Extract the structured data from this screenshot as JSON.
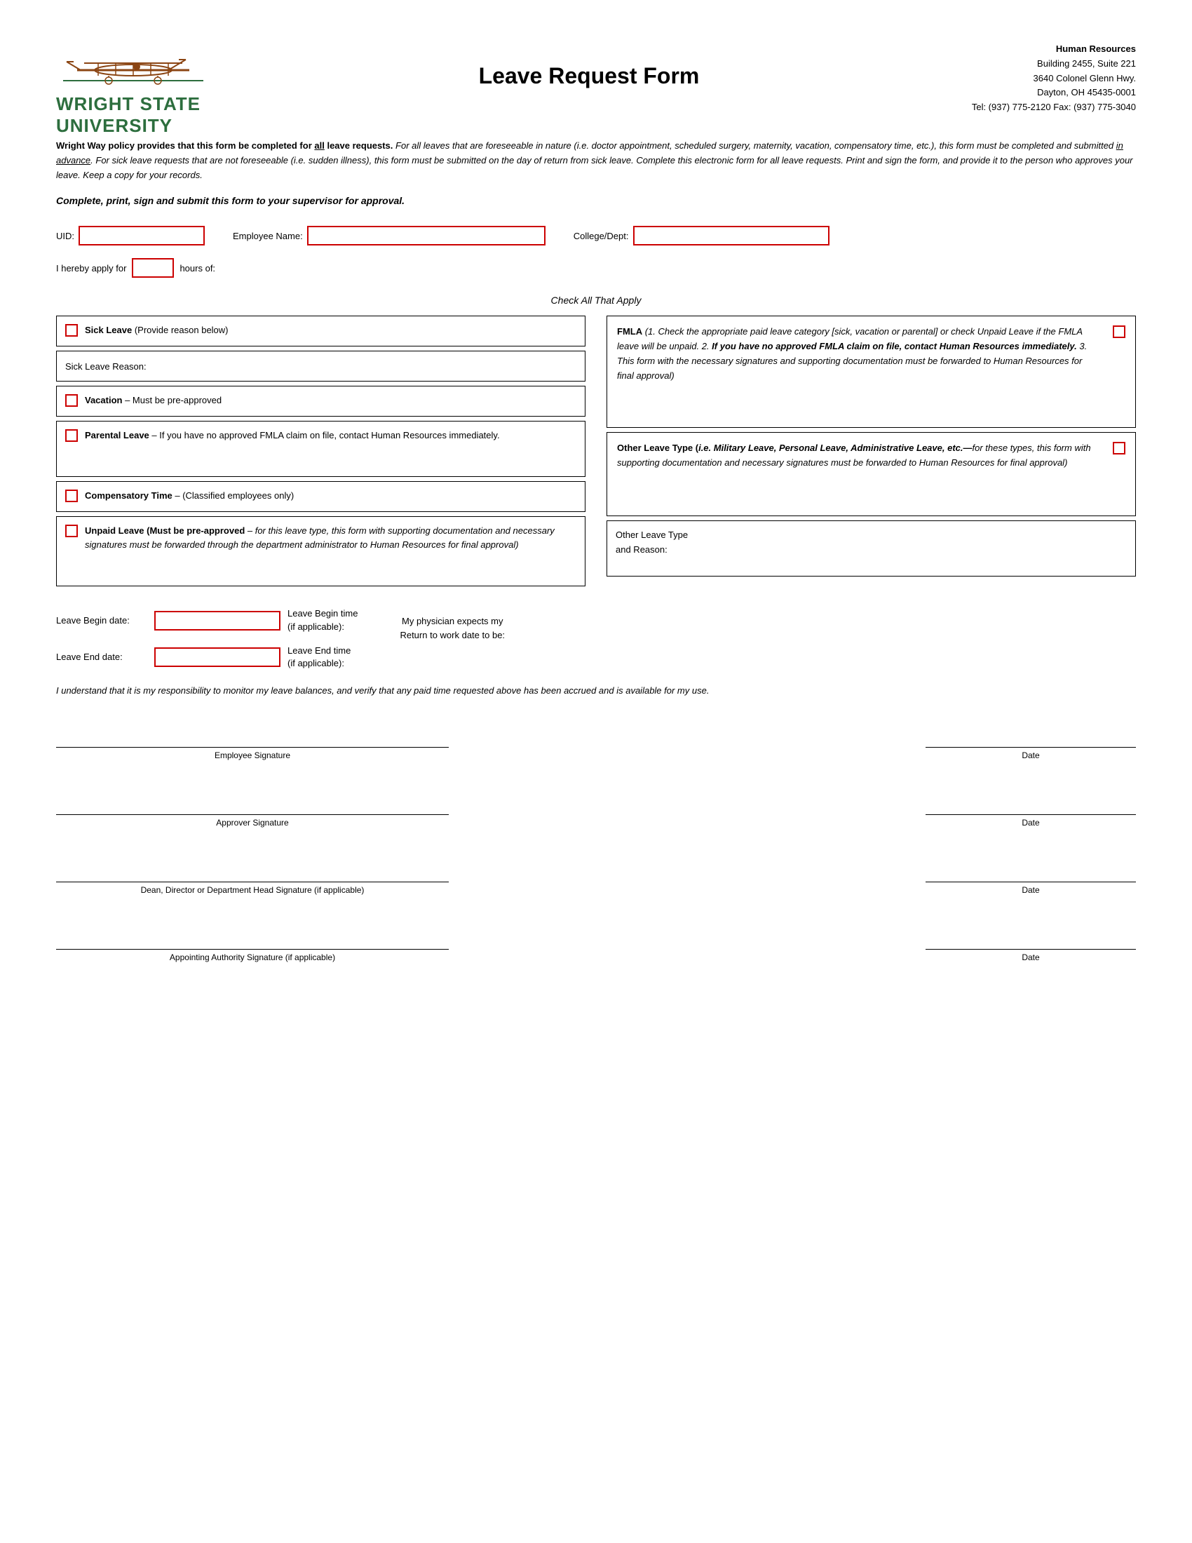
{
  "header": {
    "university_name_line1": "WRIGHT STATE",
    "university_name_line2": "UNIVERSITY",
    "form_title": "Leave Request Form",
    "hr_label": "Human Resources",
    "hr_building": "Building 2455, Suite 221",
    "hr_address": "3640 Colonel Glenn Hwy.",
    "hr_city": "Dayton, OH 45435-0001",
    "hr_tel_fax": "Tel: (937) 775-2120   Fax: (937) 775-3040"
  },
  "policy": {
    "bold_intro": "Wright Way policy provides that this form be completed for ",
    "underline_all": "all",
    "bold_intro2": " leave requests.",
    "italic_text": " For all leaves that are foreseeable in nature (i.e. doctor appointment, scheduled surgery, maternity, vacation, compensatory time, etc.), this form must be completed and submitted ",
    "underline_advance": "in advance",
    "italic_text2": ".  For sick leave requests that are not foreseeable",
    "italic_text3": " (i.e. sudden illness), this form must be submitted on the day of return from sick leave.  Complete this electronic form for all leave requests.  Print and sign the form, and provide it to the person who approves your leave.  Keep a copy for your records."
  },
  "submit_instruction": "Complete, print, sign and submit this form to your supervisor for approval.",
  "fields": {
    "uid_label": "UID:",
    "employee_name_label": "Employee Name:",
    "college_dept_label": "College/Dept:",
    "hours_prefix": "I hereby apply for",
    "hours_suffix": "hours of:"
  },
  "check_all_label": "Check All That Apply",
  "leave_options": {
    "sick_leave_label": "Sick Leave",
    "sick_leave_suffix": " (Provide reason below)",
    "sick_leave_reason_label": "Sick Leave Reason:",
    "vacation_label": "Vacation",
    "vacation_suffix": " – Must be pre-approved",
    "parental_label": "Parental Leave",
    "parental_suffix": " – If you have no approved FMLA claim on file, contact Human Resources immediately.",
    "comp_time_label": "Compensatory Time",
    "comp_time_suffix": " – (Classified employees only)",
    "unpaid_leave_bold": "Unpaid Leave (Must be pre-approved",
    "unpaid_leave_italic": " – for this leave type, this form with supporting documentation and necessary signatures must be forwarded through the department administrator to Human Resources for final approval)",
    "fmla_bold": "FMLA",
    "fmla_italic": " (1. Check the appropriate paid leave category [sick, vacation or parental] or check Unpaid Leave if the FMLA leave will be unpaid.  2. ",
    "fmla_bold2": "If you have no approved FMLA claim on file, contact Human Resources immediately.",
    "fmla_italic2": "  3. This form with the necessary signatures and supporting documentation must be forwarded to Human Resources for final approval)",
    "other_leave_bold": "Other Leave Type (",
    "other_leave_bold_italic": "i.e. Military Leave, Personal Leave, Administrative Leave, etc.",
    "other_leave_italic": "—for these types, this form with supporting documentation and necessary signatures must be forwarded to Human Resources for final approval)",
    "other_leave_type_label": "Other Leave Type",
    "other_leave_reason_label": "and Reason:"
  },
  "dates": {
    "begin_label": "Leave Begin date:",
    "begin_time_label": "Leave Begin time\n(if applicable):",
    "end_label": "Leave End date:",
    "end_time_label": "Leave End time\n(if applicable):",
    "physician_text": "My physician expects my\nReturn to work date to be:"
  },
  "disclaimer": "I understand that it is my responsibility to monitor my leave balances, and verify that any paid time requested above has been accrued and is available for my use.",
  "signatures": {
    "employee_sig_label": "Employee Signature",
    "date_label": "Date",
    "approver_sig_label": "Approver Signature",
    "dean_sig_label": "Dean, Director or Department Head Signature (if applicable)",
    "appointing_sig_label": "Appointing Authority Signature (if applicable)"
  }
}
